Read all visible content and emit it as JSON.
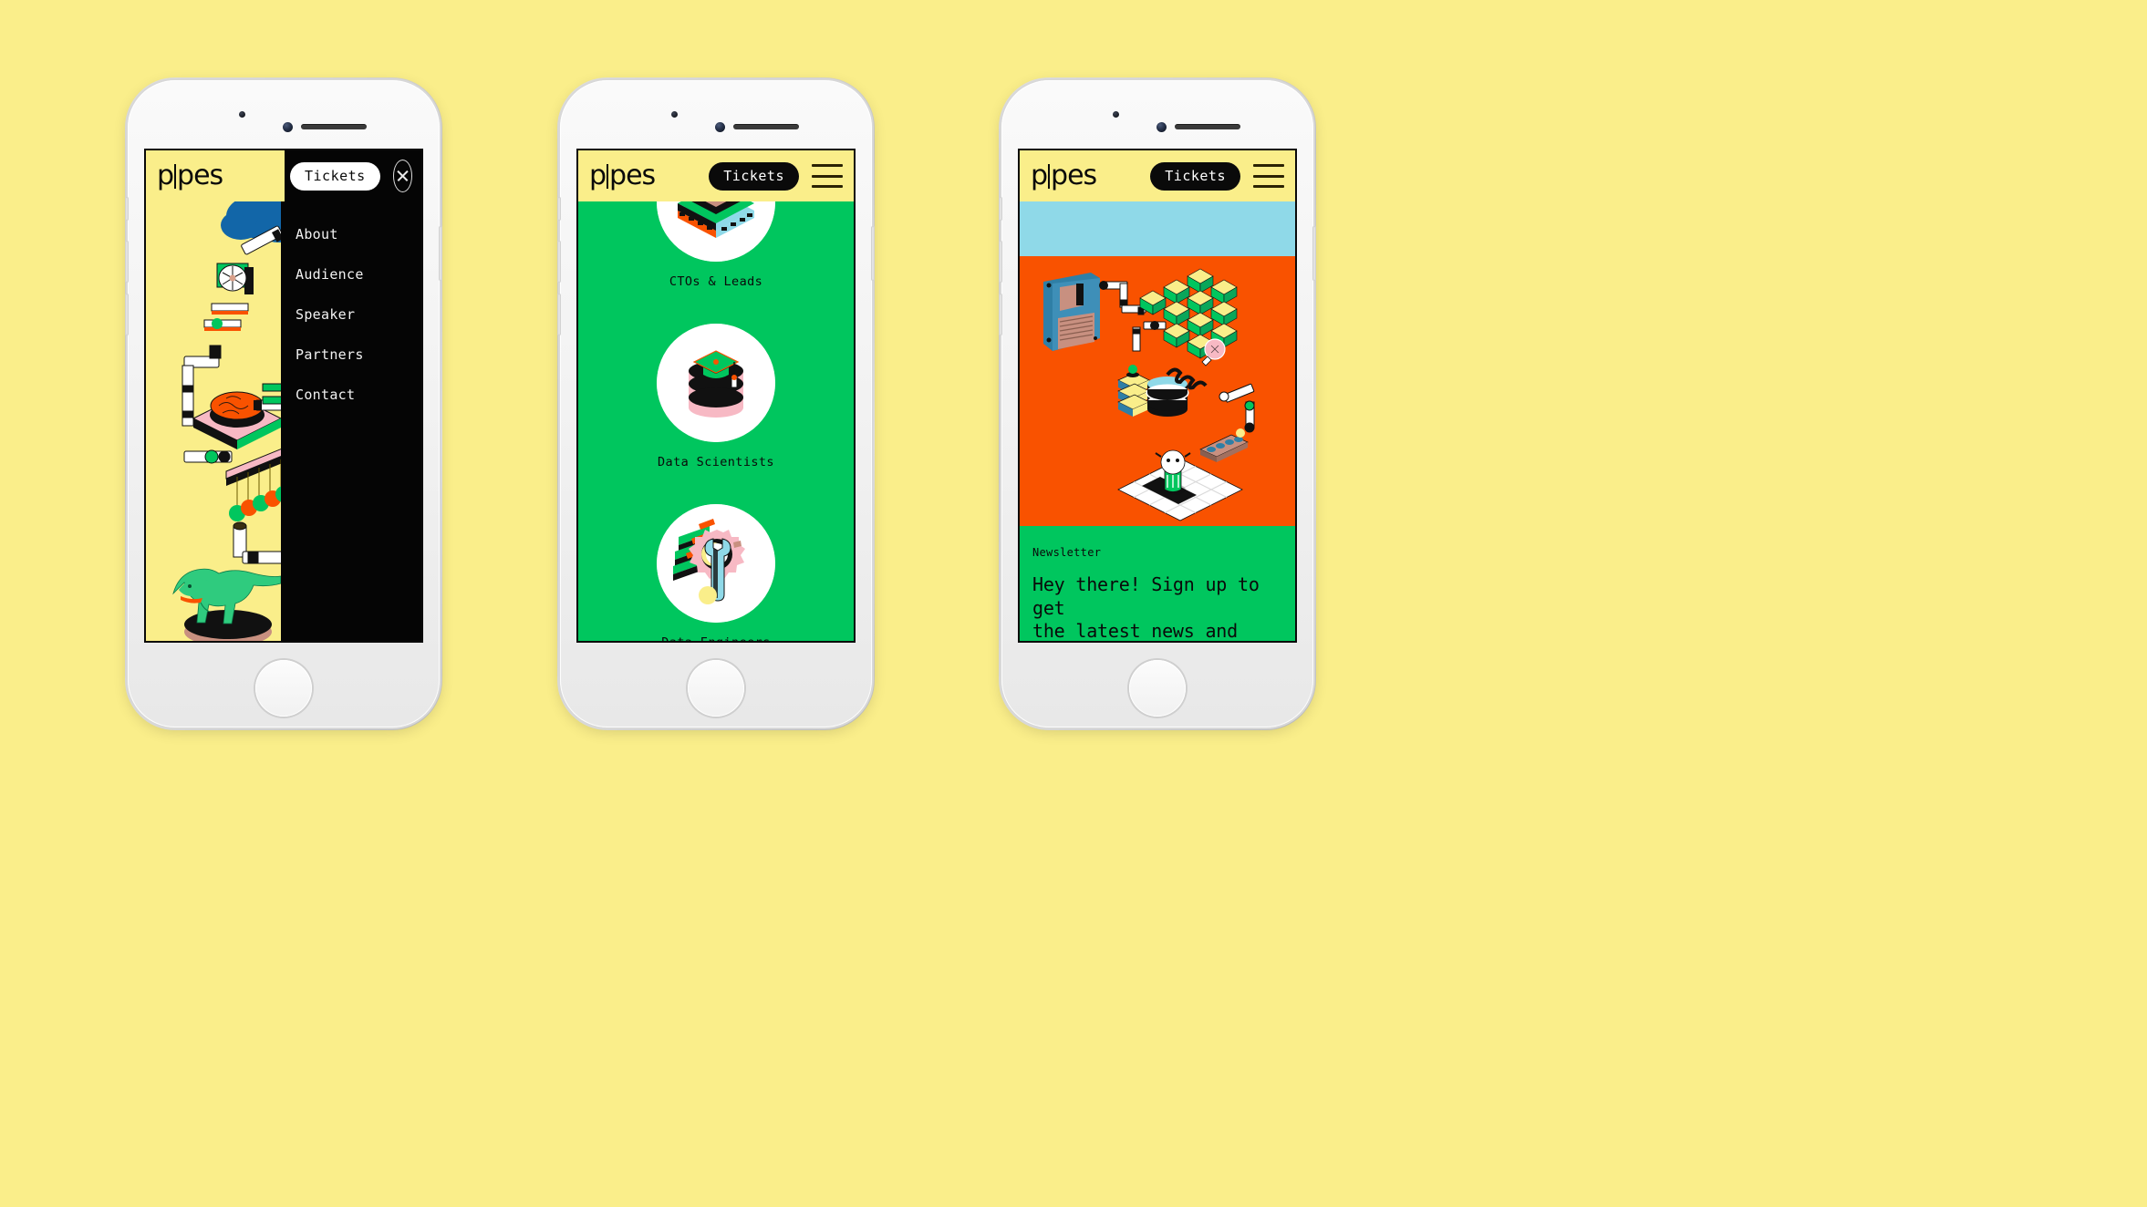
{
  "page": {
    "background_color": "#FAEE8A",
    "device_count": 3
  },
  "brand": {
    "logo_left": "p",
    "logo_right": "pes",
    "logo_full": "p|pes",
    "colors": {
      "yellow": "#FAEE8A",
      "green": "#00C65E",
      "orange": "#F95200",
      "light_blue": "#8FD9E8",
      "black": "#050505",
      "white": "#FFFFFF",
      "pink": "#F7B9C4",
      "blue": "#1266A8"
    }
  },
  "phones": [
    {
      "id": "phone-menu-open",
      "screen_bg": "#FAEE8A",
      "header": {
        "logo": "p|pes",
        "tickets_label": "Tickets",
        "tickets_style": "light-pill",
        "close_icon": "close-icon"
      },
      "menu": {
        "background": "#050505",
        "items": [
          {
            "label": "About"
          },
          {
            "label": "Audience"
          },
          {
            "label": "Speaker"
          },
          {
            "label": "Partners"
          },
          {
            "label": "Contact"
          }
        ]
      },
      "illustration": {
        "name": "data-pipeline-isometric",
        "elements": [
          "blue-cloud",
          "cooling-fan",
          "circuit-board",
          "orange-brain",
          "newtons-cradle",
          "green-t-rex",
          "pipes"
        ]
      }
    },
    {
      "id": "phone-audience",
      "screen_bg": "#00C65E",
      "header": {
        "logo": "p|pes",
        "tickets_label": "Tickets",
        "tickets_style": "dark-pill",
        "menu_icon": "hamburger-icon"
      },
      "audience": {
        "items": [
          {
            "label": "CTOs & Leads",
            "icon": "stacked-chip-icon",
            "partial": true
          },
          {
            "label": "Data Scientists",
            "icon": "database-graduation-cap-icon",
            "partial": false
          },
          {
            "label": "Data Engineers",
            "icon": "gear-wrench-icon",
            "partial": false
          }
        ]
      }
    },
    {
      "id": "phone-newsletter",
      "screen_bg": "#F95200",
      "header": {
        "logo": "p|pes",
        "tickets_label": "Tickets",
        "tickets_style": "dark-pill",
        "menu_icon": "hamburger-icon"
      },
      "bands": [
        {
          "name": "sky-band",
          "color": "#8FD9E8"
        },
        {
          "name": "illustration-band",
          "color": "#F95200"
        },
        {
          "name": "newsletter-band",
          "color": "#00C65E"
        }
      ],
      "illustration": {
        "name": "data-factory-isometric",
        "elements": [
          "floppy-disk",
          "data-cube-grid",
          "server-rack",
          "database-barrel",
          "spring-bulb",
          "conveyor-belt",
          "robot-arm",
          "grid-platform",
          "pipes"
        ]
      },
      "newsletter": {
        "kicker": "Newsletter",
        "headline_line_1": "Hey there! Sign up to get",
        "headline_line_2": "the latest news and"
      }
    }
  ]
}
